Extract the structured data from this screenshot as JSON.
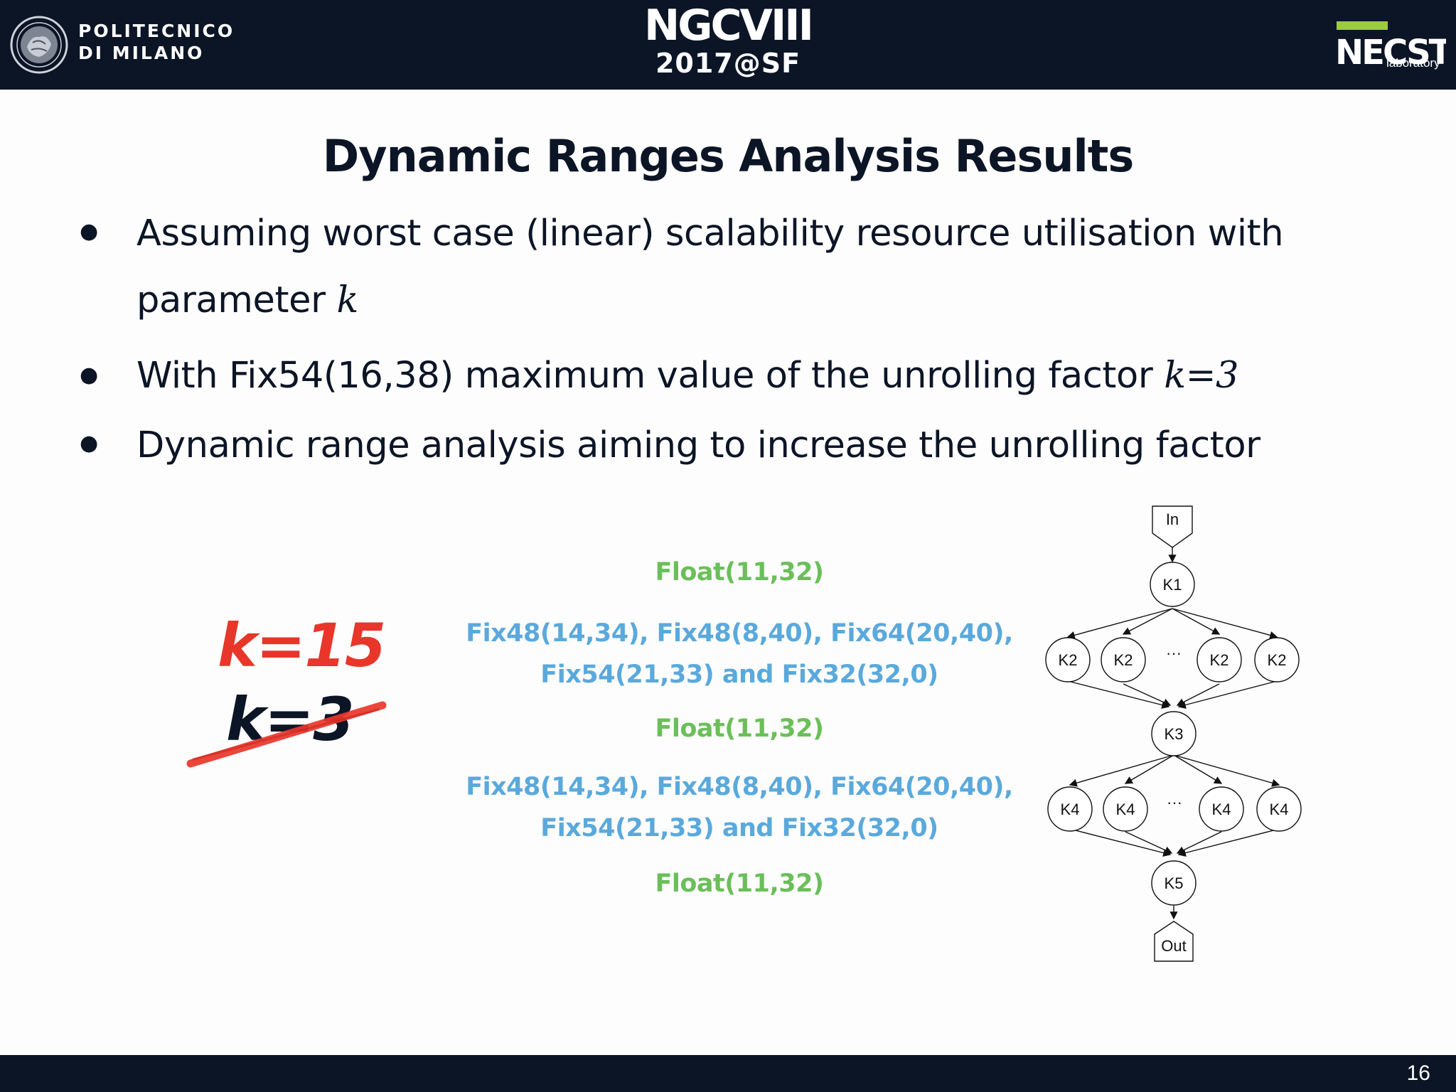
{
  "header": {
    "institution_line1": "POLITECNICO",
    "institution_line2": "DI MILANO",
    "conference": "NGCVIII",
    "conference_sub": "2017@SF",
    "lab_brand": "NECST",
    "lab_sub": "laboratory"
  },
  "slide": {
    "title": "Dynamic Ranges Analysis Results",
    "bullets": [
      {
        "line1": "Assuming worst case (linear) scalability resource utilisation with",
        "line2": "parameter ",
        "math": "k"
      },
      {
        "text": "With Fix54(16,38)  maximum value of the unrolling factor ",
        "math": "k=3"
      },
      {
        "text": "Dynamic range analysis aiming to increase the unrolling factor"
      }
    ],
    "k_new": "k=15",
    "k_old": "k=3",
    "formats": {
      "float1": "Float(11,32)",
      "fix1_line1": "Fix48(14,34), Fix48(8,40), Fix64(20,40),",
      "fix1_line2": "Fix54(21,33) and Fix32(32,0)",
      "float2": "Float(11,32)",
      "fix2_line1": "Fix48(14,34), Fix48(8,40), Fix64(20,40),",
      "fix2_line2": "Fix54(21,33) and Fix32(32,0)",
      "float3": "Float(11,32)"
    }
  },
  "diagram": {
    "input": "In",
    "output": "Out",
    "k1": "K1",
    "k2_nodes": [
      "K2",
      "K2",
      "K2",
      "K2"
    ],
    "k3": "K3",
    "k4_nodes": [
      "K4",
      "K4",
      "K4",
      "K4"
    ],
    "k5": "K5",
    "ellipsis": "···"
  },
  "footer": {
    "page_number": "16"
  },
  "colors": {
    "navy": "#0c1526",
    "red": "#e8362b",
    "green": "#6bbf59",
    "blue": "#5aa9dc",
    "lime": "#9ccb3b"
  }
}
